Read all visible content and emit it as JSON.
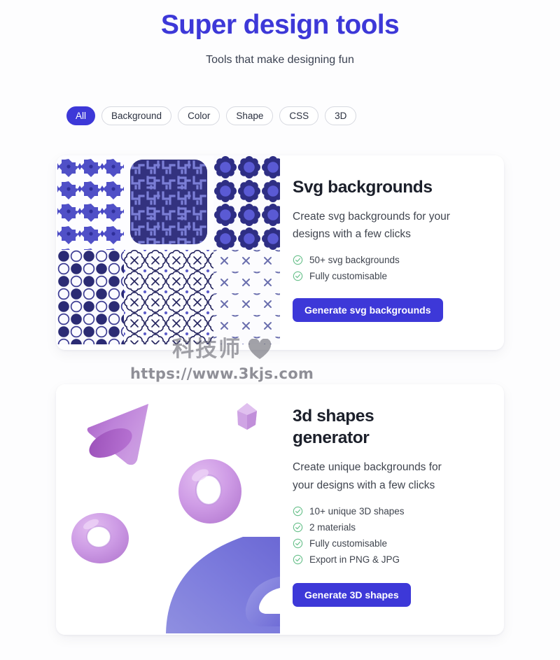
{
  "hero": {
    "title": "Super design tools",
    "subtitle": "Tools that make designing fun"
  },
  "filters": {
    "items": [
      {
        "label": "All",
        "active": true
      },
      {
        "label": "Background",
        "active": false
      },
      {
        "label": "Color",
        "active": false
      },
      {
        "label": "Shape",
        "active": false
      },
      {
        "label": "CSS",
        "active": false
      },
      {
        "label": "3D",
        "active": false
      }
    ]
  },
  "cards": [
    {
      "title": "Svg backgrounds",
      "description": "Create svg backgrounds for your designs with a few clicks",
      "features": [
        "50+ svg backgrounds",
        "Fully customisable"
      ],
      "cta_label": "Generate svg backgrounds",
      "media": {
        "kind": "svg-pattern-grid",
        "patterns": [
          "floral-diamond-pattern",
          "maze-elbow-pattern",
          "flower-gear-pattern",
          "circle-checker-pattern",
          "quatrefoil-cross-pattern",
          "sparse-x-pattern"
        ]
      }
    },
    {
      "title": "3d shapes generator",
      "description": "Create unique backgrounds for your designs with a few clicks",
      "features": [
        "10+ unique 3D shapes",
        "2 materials",
        "Fully customisable",
        "Export in PNG & JPG"
      ],
      "cta_label": "Generate 3D shapes",
      "media": {
        "kind": "3d-shapes",
        "shapes": [
          "cone-shape",
          "gem-shape",
          "torus-large-shape",
          "torus-small-shape",
          "curved-surface-shape"
        ]
      }
    }
  ],
  "watermark": {
    "brand": "科技师",
    "url": "https://www.3kjs.com",
    "icon": "heart-icon"
  },
  "colors": {
    "accent": "#3d38d8",
    "title": "#3d38d8",
    "pattern_dark": "#2a2a7a",
    "pattern_mid": "#4746c4",
    "pattern_light": "#6f72d8",
    "check_green": "#67c08a",
    "shape_purple": "#c59ae0",
    "shape_blue": "#7b7ae0",
    "page_bg": "#fdfdfe",
    "card_bg": "#ffffff"
  }
}
